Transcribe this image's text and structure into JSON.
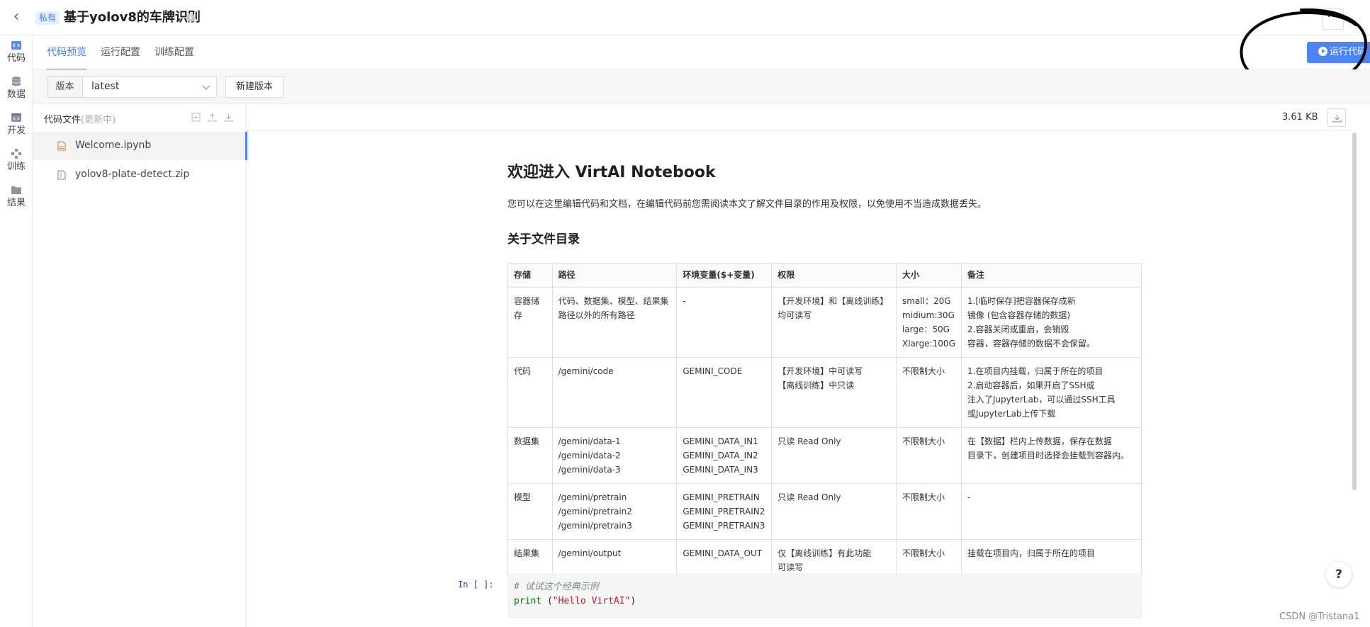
{
  "header": {
    "back_glyph": "‹",
    "badge": "私有",
    "title": "基于yolov8的车牌识别",
    "info_glyph": "i",
    "more_glyph": "···"
  },
  "rail": {
    "items": [
      {
        "label": "代码",
        "icon": "code-icon"
      },
      {
        "label": "数据",
        "icon": "database-icon"
      },
      {
        "label": "开发",
        "icon": "dev-icon"
      },
      {
        "label": "训练",
        "icon": "train-icon"
      },
      {
        "label": "结果",
        "icon": "folder-icon"
      }
    ]
  },
  "tabs": {
    "items": [
      {
        "label": "代码预览",
        "active": true
      },
      {
        "label": "运行配置",
        "active": false
      },
      {
        "label": "训练配置",
        "active": false
      }
    ],
    "run_button": "运行代码"
  },
  "version": {
    "label": "版本",
    "value": "latest",
    "new_button": "新建版本"
  },
  "files": {
    "title": "代码文件",
    "subtitle": "(更新中)",
    "items": [
      {
        "name": "Welcome.ipynb",
        "active": true
      },
      {
        "name": "yolov8-plate-detect.zip",
        "active": false
      }
    ]
  },
  "content": {
    "file_size": "3.61 KB"
  },
  "notebook": {
    "h1": "欢迎进入 VirtAI Notebook",
    "intro": "您可以在这里编辑代码和文档，在编辑代码前您需阅读本文了解文件目录的作用及权限，以免使用不当造成数据丢失。",
    "h2": "关于文件目录",
    "table": {
      "headers": [
        "存储",
        "路径",
        "环境变量($+变量)",
        "权限",
        "大小",
        "备注"
      ],
      "rows": [
        {
          "storage": "容器储存",
          "path": [
            "代码、数据集、模型、结果集",
            "路径以外的所有路径"
          ],
          "env": [
            "-"
          ],
          "perm": [
            "【开发环境】和【离线训练】",
            "均可读写"
          ],
          "size": [
            "small：20G",
            "midium:30G",
            "large：50G",
            "Xlarge:100G"
          ],
          "note": [
            "1.[临时保存]把容器保存成新",
            "镜像 (包含容器存储的数据)",
            "2.容器关闭或重启，会销毁",
            "容器，容器存储的数据不会保留。"
          ]
        },
        {
          "storage": "代码",
          "path": [
            "/gemini/code"
          ],
          "env": [
            "GEMINI_CODE"
          ],
          "perm": [
            "【开发环境】中可读写",
            "【离线训练】中只读"
          ],
          "size": [
            "不限制大小"
          ],
          "note": [
            "1.在项目内挂载，归属于所在的项目",
            "2.启动容器后，如果开启了SSH或",
            "注入了JupyterLab，可以通过SSH工具",
            "或JupyterLab上传下载"
          ]
        },
        {
          "storage": "数据集",
          "path": [
            "/gemini/data-1",
            "/gemini/data-2",
            "/gemini/data-3"
          ],
          "env": [
            "GEMINI_DATA_IN1",
            "GEMINI_DATA_IN2",
            "GEMINI_DATA_IN3"
          ],
          "perm": [
            "只读 Read Only"
          ],
          "size": [
            "不限制大小"
          ],
          "note": [
            "在【数据】栏内上传数据，保存在数据",
            "目录下，创建项目时选择会挂载到容器内。"
          ]
        },
        {
          "storage": "模型",
          "path": [
            "/gemini/pretrain",
            "/gemini/pretrain2",
            "/gemini/pretrain3"
          ],
          "env": [
            "GEMINI_PRETRAIN",
            "GEMINI_PRETRAIN2",
            "GEMINI_PRETRAIN3"
          ],
          "perm": [
            "只读 Read Only"
          ],
          "size": [
            "不限制大小"
          ],
          "note": [
            "-"
          ]
        },
        {
          "storage": "结果集",
          "path": [
            "/gemini/output"
          ],
          "env": [
            "GEMINI_DATA_OUT"
          ],
          "perm": [
            "仅【离线训练】有此功能",
            "可读写"
          ],
          "size": [
            "不限制大小"
          ],
          "note": [
            "挂载在项目内，归属于所在的项目"
          ]
        }
      ]
    },
    "cell_prompt": "In [ ]:",
    "code": {
      "comment": "# 试试这个经典示例",
      "keyword": "print",
      "rest_open": " (",
      "string": "\"Hello VirtAI\"",
      "rest_close": ")"
    }
  },
  "help_glyph": "?",
  "watermark": "CSDN @Tristana1",
  "colors": {
    "accent": "#3b7cf6",
    "run_button": "#4c84f4"
  }
}
